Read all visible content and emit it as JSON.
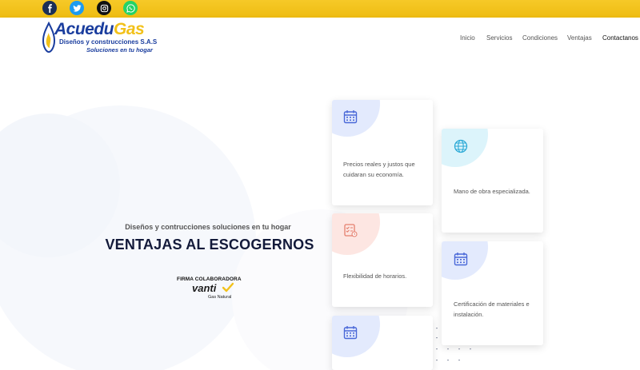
{
  "social": [
    {
      "icon": "facebook-icon",
      "color": "#1b2f56"
    },
    {
      "icon": "twitter-icon",
      "color": "#1d9bf0"
    },
    {
      "icon": "instagram-icon",
      "color": "#111111"
    },
    {
      "icon": "whatsapp-icon",
      "color": "#25d366"
    }
  ],
  "logo": {
    "name_part1": "Acuedu",
    "name_part2": "Gas",
    "subtitle": "Diseños y construcciones S.A.S",
    "tagline": "Soluciones en tu hogar"
  },
  "nav": {
    "items": [
      {
        "label": "Inicio"
      },
      {
        "label": "Servicios"
      },
      {
        "label": "Condiciones"
      },
      {
        "label": "Ventajas"
      },
      {
        "label": "Contactanos"
      }
    ]
  },
  "hero": {
    "subtitle": "Diseños y contrucciones soluciones en tu hogar",
    "title": "VENTAJAS AL ESCOGERNOS",
    "partner": {
      "firma": "FIRMA COLABORADORA",
      "brand": "vanti",
      "brand_sub": "Gas Natural"
    }
  },
  "cards": [
    {
      "icon": "calendar-icon",
      "text": "Precios reales y justos que cuidaran su economía."
    },
    {
      "icon": "globe-icon",
      "text": "Mano de obra especializada."
    },
    {
      "icon": "checklist-icon",
      "text": "Flexibilidad de horarios."
    },
    {
      "icon": "calendar-icon",
      "text": "Certificación de materiales e instalación."
    },
    {
      "icon": "calendar-icon",
      "text": ""
    }
  ],
  "colors": {
    "topbar": "#f2c11a",
    "brand_blue": "#1a3d9e",
    "brand_yellow": "#f2c11a",
    "title": "#131a3a"
  }
}
